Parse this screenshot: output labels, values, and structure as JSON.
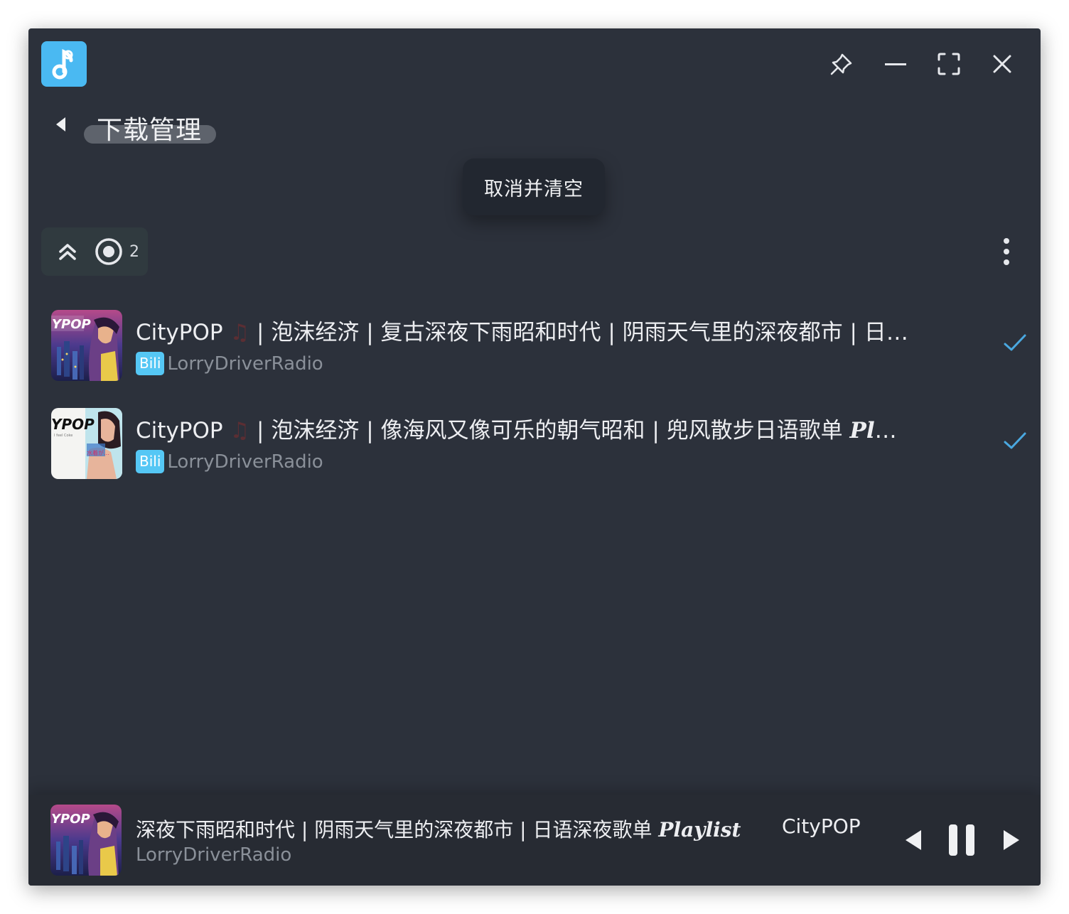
{
  "window": {
    "app_icon": "music-note-icon",
    "controls": [
      "pin-icon",
      "minimize-icon",
      "fullscreen-icon",
      "close-icon"
    ]
  },
  "header": {
    "back_icon": "back-arrow-icon",
    "title": "下载管理"
  },
  "tooltip": {
    "text": "取消并清空"
  },
  "toolbar": {
    "collapse_icon": "double-chevron-up-icon",
    "status_icon": "radio-target-icon",
    "count": "2",
    "more_icon": "more-vertical-icon"
  },
  "downloads": [
    {
      "title_prefix": "CityPOP",
      "title_note": "♫",
      "title_main": " | 泡沫经济 | 复古深夜下雨昭和时代 | 阴雨天气里的深夜都市 | 日语深夜歌…",
      "title_suffix": "",
      "source_badge": "Bili",
      "artist": "LorryDriverRadio",
      "status_icon": "check-icon"
    },
    {
      "title_prefix": "CityPOP",
      "title_note": "♫",
      "title_main": " | 泡沫经济 | 像海风又像可乐的朝气昭和 | 兜风散步日语歌单 ",
      "title_suffix": "Playlist",
      "source_badge": "Bili",
      "artist": "LorryDriverRadio",
      "status_icon": "check-icon"
    }
  ],
  "player": {
    "title_scroll": "深夜下雨昭和时代 | 阴雨天气里的深夜都市 | 日语深夜歌单 ",
    "title_suffix": "Playlist",
    "title_ghost": "CityPOP",
    "artist": "LorryDriverRadio",
    "controls": [
      "previous-icon",
      "pause-icon",
      "next-icon"
    ]
  },
  "colors": {
    "background": "#2c313b",
    "accent": "#4ab9f2",
    "badge": "#55c7f5",
    "check": "#4aa8e0"
  }
}
